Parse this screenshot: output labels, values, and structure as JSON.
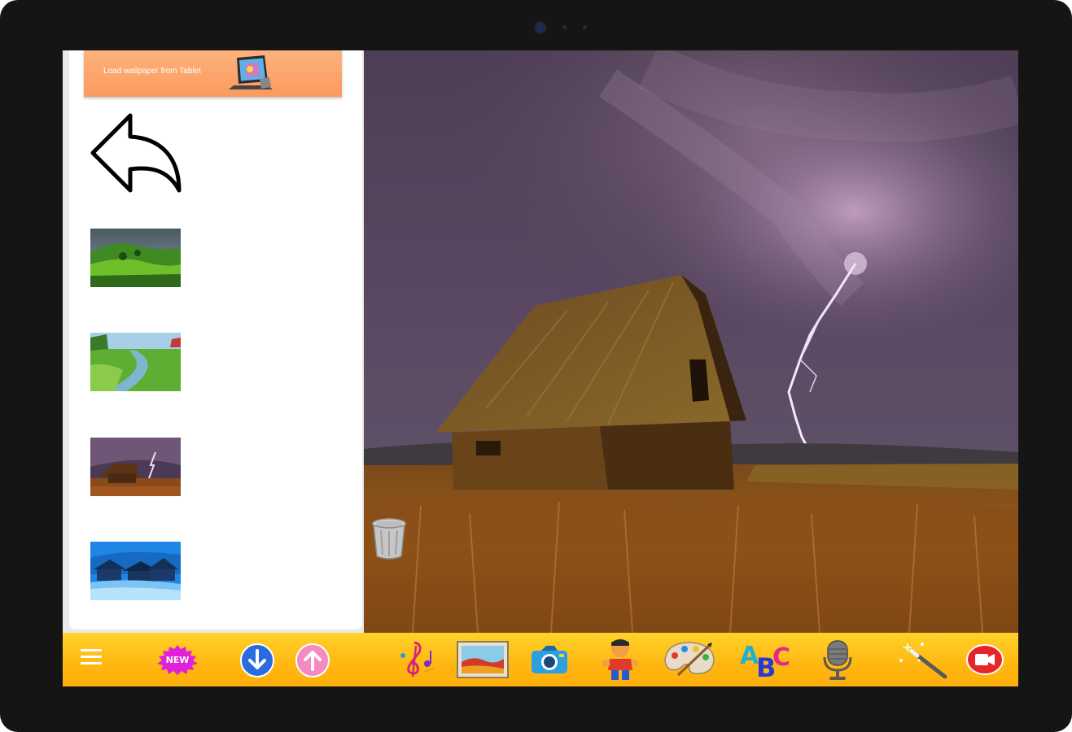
{
  "sidebar": {
    "load_wallpaper_label": "Load wallpaper from Tablet",
    "thumbnails": [
      {
        "name": "green-hills-thumbnail"
      },
      {
        "name": "stream-meadow-thumbnail"
      },
      {
        "name": "barn-lightning-thumbnail"
      },
      {
        "name": "winter-village-thumbnail"
      }
    ]
  },
  "toolbar": {
    "new_label": "NEW",
    "items": [
      "menu-icon",
      "new-badge",
      "download-icon",
      "upload-icon",
      "music-icon",
      "picture-frame-icon",
      "camera-icon",
      "character-icon",
      "paint-palette-icon",
      "abc-letters-icon",
      "microphone-icon",
      "magic-wand-icon",
      "video-record-icon"
    ]
  },
  "colors": {
    "bezel": "#151515",
    "load_button": "#fb9a5e",
    "toolbar": "#ffb711",
    "sky": "#5a4660"
  }
}
